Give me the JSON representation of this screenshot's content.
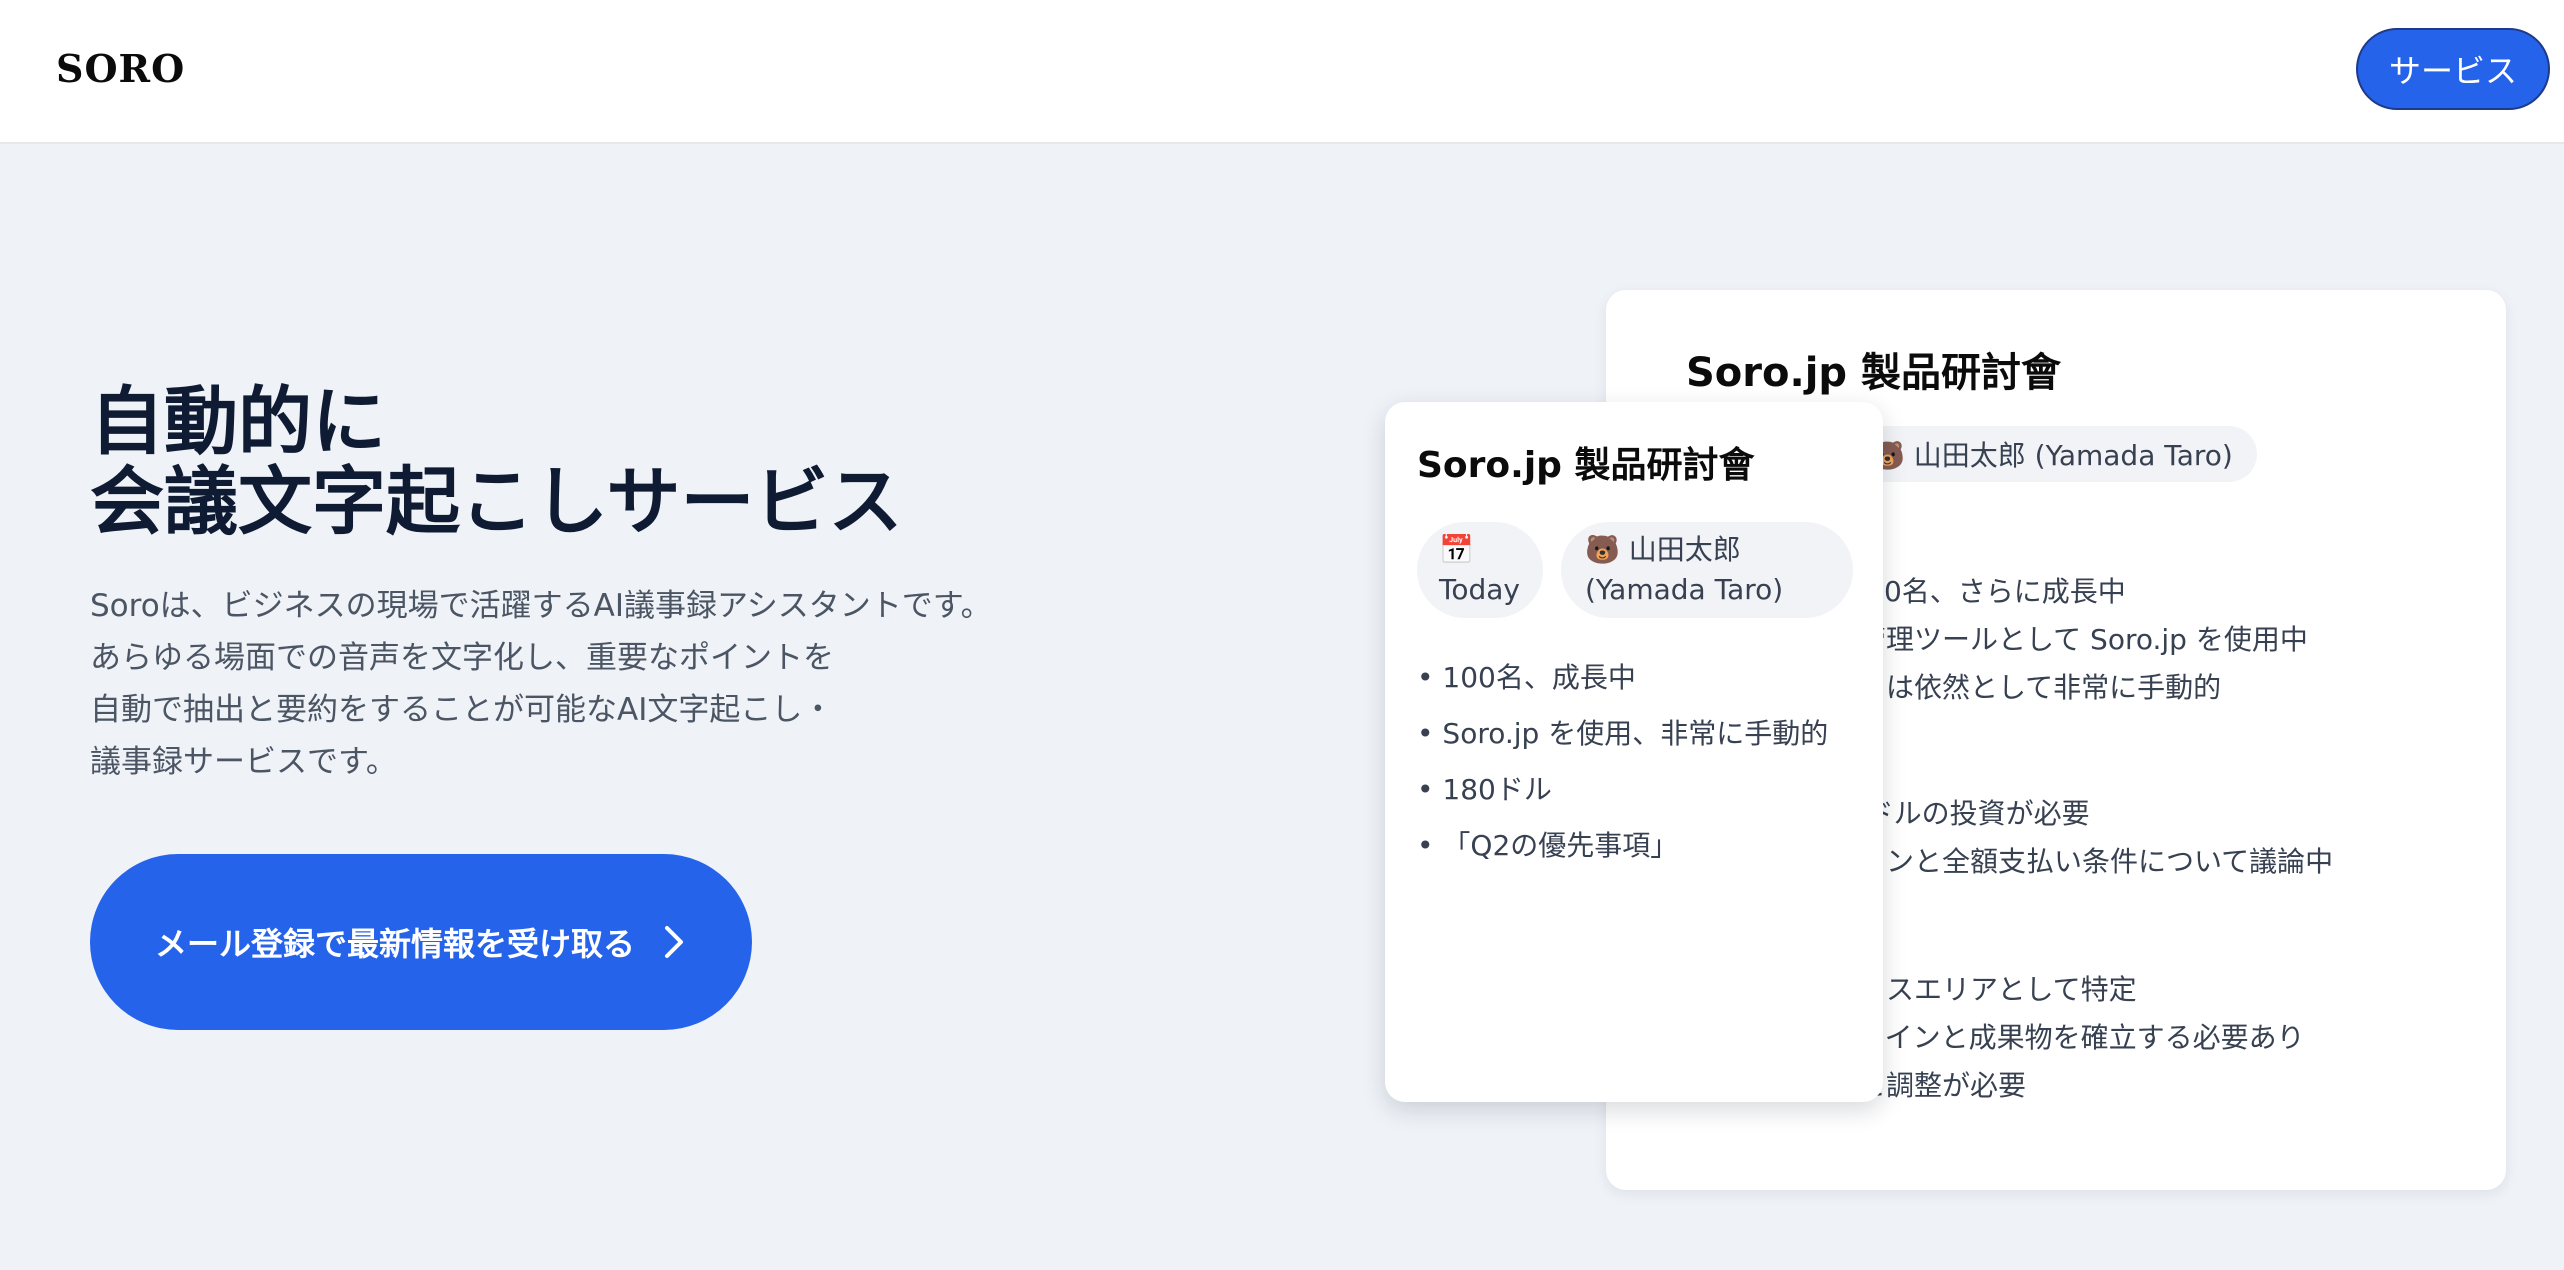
{
  "header": {
    "logo": "SORO",
    "nav_button": "サービス"
  },
  "hero": {
    "title_lines": [
      "自動的に",
      "会議文字起こしサービス"
    ],
    "description_lines": [
      "Soroは、ビジネスの現場で活躍するAI議事録アシスタントです。",
      "あらゆる場面での音声を文字化し、重要なポイントを",
      "自動で抽出と要約をすることが可能なAI文字起こし・",
      "議事録サービスです。"
    ],
    "cta_label": "メール登録で最新情報を受け取る",
    "cta_icon": "chevron-right-icon"
  },
  "back_card": {
    "title": "Soro.jp 製品研討會",
    "user_chip": "🐻 山田太郎 (Yamada Taro)",
    "lines": [
      ": 100名、さらに成長中",
      "ト管理ツールとして Soro.jp を使用中",
      "ェスは依然として非常に手動的",
      "30ドルの投資が必要",
      "ションと全額支払い条件について議論中",
      "ーカスエリアとして特定",
      "ムラインと成果物を確立する必要あり",
      "論と調整が必要"
    ]
  },
  "front_card": {
    "title": "Soro.jp 製品研討會",
    "date_chip": [
      "📅",
      "Today"
    ],
    "user_chip": [
      "🐻 山田太郎",
      "(Yamada Taro)"
    ],
    "bullets": [
      "• 100名、成長中",
      "• Soro.jp を使用、非常に手動的",
      "• 180ドル",
      "• 「Q2の優先事項」"
    ]
  },
  "colors": {
    "accent": "#2563eb",
    "background": "#eff3f8",
    "heading": "#0f1b33"
  }
}
